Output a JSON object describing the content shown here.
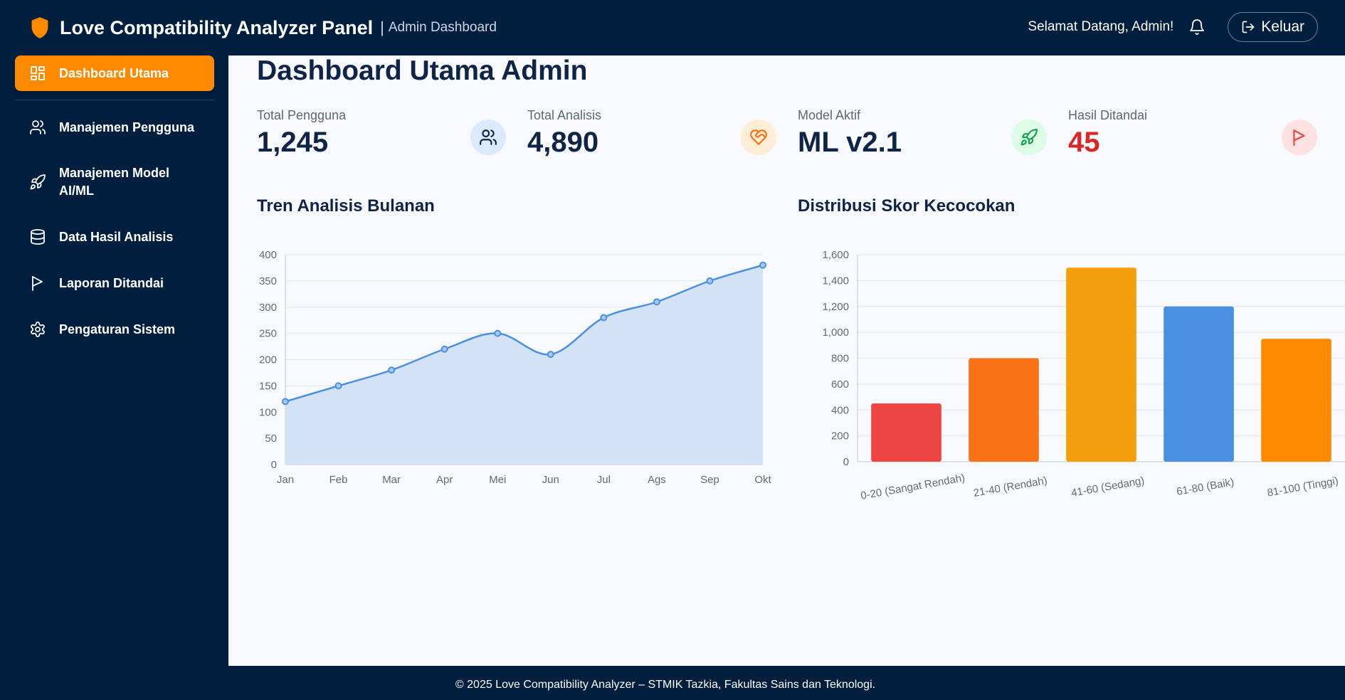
{
  "header": {
    "title": "Love Compatibility Analyzer Panel",
    "separator": "|",
    "subtitle": "Admin Dashboard",
    "welcome": "Selamat Datang, Admin!",
    "logout_label": "Keluar"
  },
  "sidebar": {
    "items": [
      {
        "label": "Dashboard Utama",
        "icon": "dashboard-icon",
        "active": true
      },
      {
        "label": "Manajemen Pengguna",
        "icon": "users-icon"
      },
      {
        "label": "Manajemen Model AI/ML",
        "icon": "rocket-icon"
      },
      {
        "label": "Data Hasil Analisis",
        "icon": "database-icon"
      },
      {
        "label": "Laporan Ditandai",
        "icon": "flag-icon"
      },
      {
        "label": "Pengaturan Sistem",
        "icon": "gear-icon"
      }
    ]
  },
  "main": {
    "title": "Dashboard Utama Admin",
    "stats": [
      {
        "label": "Total Pengguna",
        "value": "1,245",
        "icon": "users-icon",
        "color": "#0f2446",
        "icon_bg": "#dbeafe"
      },
      {
        "label": "Total Analisis",
        "value": "4,890",
        "icon": "heart-handshake-icon",
        "color": "#0f2446",
        "icon_bg": "#ffedd5"
      },
      {
        "label": "Model Aktif",
        "value": "ML v2.1",
        "icon": "rocket-icon",
        "color": "#0f2446",
        "icon_bg": "#dcfce7"
      },
      {
        "label": "Hasil Ditandai",
        "value": "45",
        "icon": "flag-icon",
        "color": "#dc2626",
        "icon_bg": "#fee2e2"
      }
    ]
  },
  "charts": {
    "line_title": "Tren Analisis Bulanan",
    "bar_title": "Distribusi Skor Kecocokan"
  },
  "chart_data": [
    {
      "type": "area",
      "title": "Tren Analisis Bulanan",
      "categories": [
        "Jan",
        "Feb",
        "Mar",
        "Apr",
        "Mei",
        "Jun",
        "Jul",
        "Ags",
        "Sep",
        "Okt"
      ],
      "values": [
        120,
        150,
        180,
        220,
        250,
        210,
        280,
        310,
        350,
        380
      ],
      "ylim": [
        0,
        400
      ],
      "yticks": [
        "0",
        "50",
        "100",
        "150",
        "200",
        "250",
        "300",
        "350",
        "400"
      ],
      "grid": true,
      "color": "#4a90e2",
      "fill": "#d3e2f5"
    },
    {
      "type": "bar",
      "title": "Distribusi Skor Kecocokan",
      "categories": [
        "0-20 (Sangat Rendah)",
        "21-40 (Rendah)",
        "41-60 (Sedang)",
        "61-80 (Baik)",
        "81-100 (Tinggi)"
      ],
      "values": [
        450,
        800,
        1500,
        1200,
        950
      ],
      "colors": [
        "#ef4444",
        "#f97316",
        "#f59e0b",
        "#4a90e2",
        "#ff8a00"
      ],
      "ylim": [
        0,
        1600
      ],
      "yticks": [
        "0",
        "200",
        "400",
        "600",
        "800",
        "1,000",
        "1,200",
        "1,400",
        "1,600"
      ],
      "grid": true
    }
  ],
  "footer": {
    "text": "© 2025 Love Compatibility Analyzer – STMIK Tazkia, Fakultas Sains dan Teknologi."
  }
}
